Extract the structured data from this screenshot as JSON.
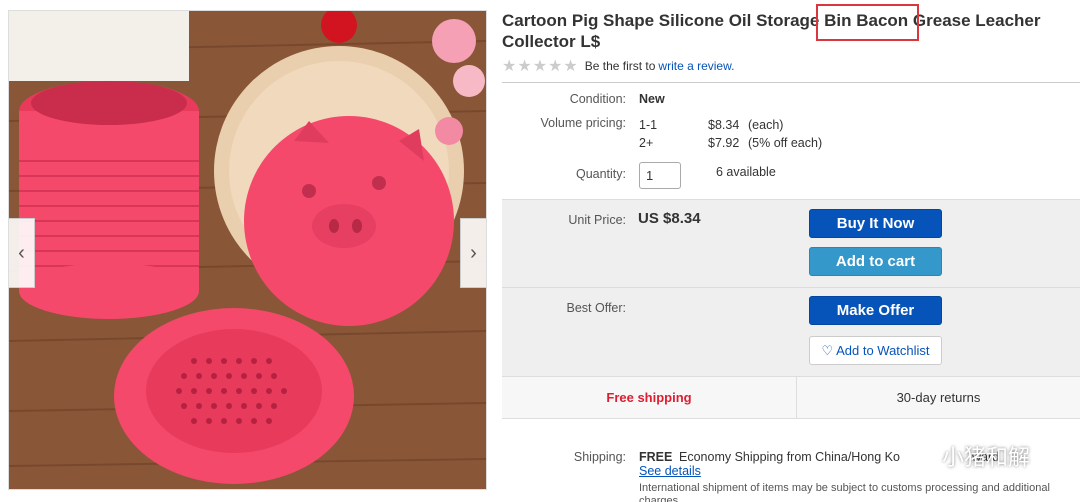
{
  "product": {
    "title": "Cartoon Pig Shape Silicone Oil Storage Bin Bacon Grease Leacher Collector L$",
    "rating_text": "Be the first to",
    "review_link": "write a review."
  },
  "details": {
    "condition_label": "Condition:",
    "condition_value": "New",
    "volume_label": "Volume pricing:",
    "tiers": [
      {
        "qty": "1-1",
        "price": "$8.34",
        "note": "(each)"
      },
      {
        "qty": "2+",
        "price": "$7.92",
        "note": "(5% off each)"
      }
    ],
    "quantity_label": "Quantity:",
    "quantity_value": "1",
    "available": "6 available"
  },
  "purchase": {
    "unit_price_label": "Unit Price:",
    "unit_price": "US $8.34",
    "buy_now": "Buy It Now",
    "add_to_cart": "Add to cart",
    "best_offer_label": "Best Offer:",
    "make_offer": "Make Offer",
    "watchlist": "Add to Watchlist",
    "free_shipping": "Free shipping",
    "returns": "30-day returns"
  },
  "shipping": {
    "label": "Shipping:",
    "free": "FREE",
    "method": "Economy Shipping from China/Hong Ko",
    "method_tail": "ward",
    "see_details": "See details",
    "intl_note": "International shipment of items may be subject to customs processing and additional",
    "intl_note2": "charges"
  },
  "watermark": {
    "text": "小猪和解"
  },
  "colors": {
    "buy_now": "#0654ba",
    "add_to_cart": "#3498ca",
    "free_shipping": "#dd1e31",
    "highlight": "#d9363e",
    "product_pink": "#f4496b"
  },
  "gallery": {
    "prev_icon": "chevron-left-icon",
    "next_icon": "chevron-right-icon"
  }
}
